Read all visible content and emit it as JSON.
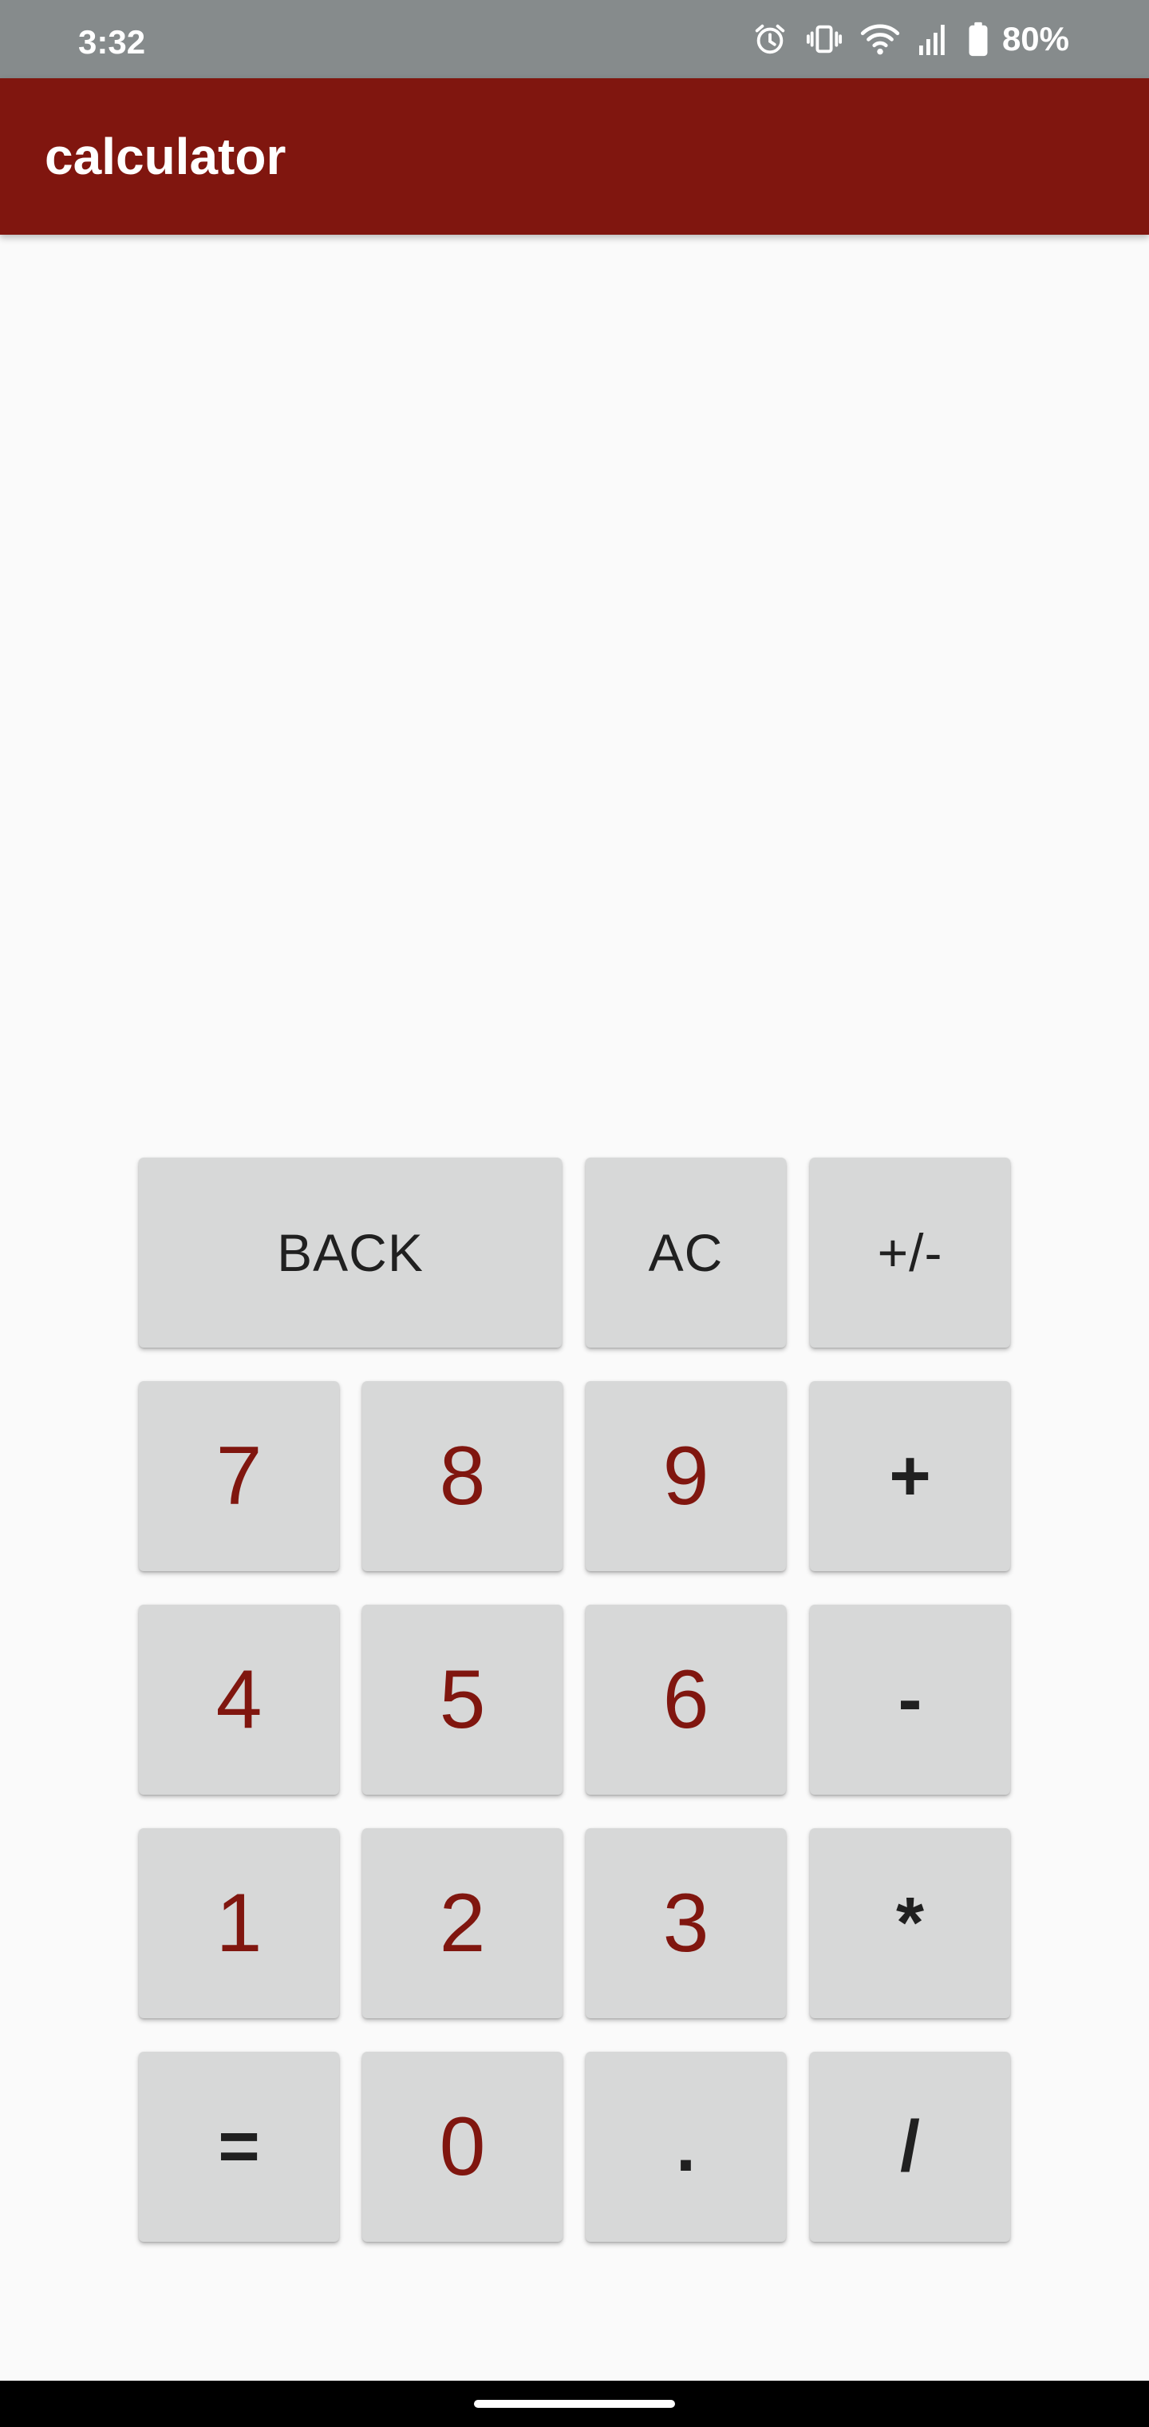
{
  "status_bar": {
    "time": "3:32",
    "battery_text": "80%",
    "icons": [
      "alarm-icon",
      "vibrate-icon",
      "wifi-icon",
      "signal-icon",
      "battery-icon"
    ]
  },
  "app_bar": {
    "title": "calculator"
  },
  "display": {
    "value": ""
  },
  "keypad": {
    "back": "BACK",
    "ac": "AC",
    "plus_minus": "+/-",
    "seven": "7",
    "eight": "8",
    "nine": "9",
    "plus": "+",
    "four": "4",
    "five": "5",
    "six": "6",
    "minus": "-",
    "one": "1",
    "two": "2",
    "three": "3",
    "multiply": "*",
    "equals": "=",
    "zero": "0",
    "decimal": ".",
    "divide": "/"
  },
  "colors": {
    "app_bar": "#80160f",
    "status_bar": "#868b8c",
    "digit_text": "#80160f",
    "key_background": "#d7d8d8",
    "background": "#fafafa"
  }
}
